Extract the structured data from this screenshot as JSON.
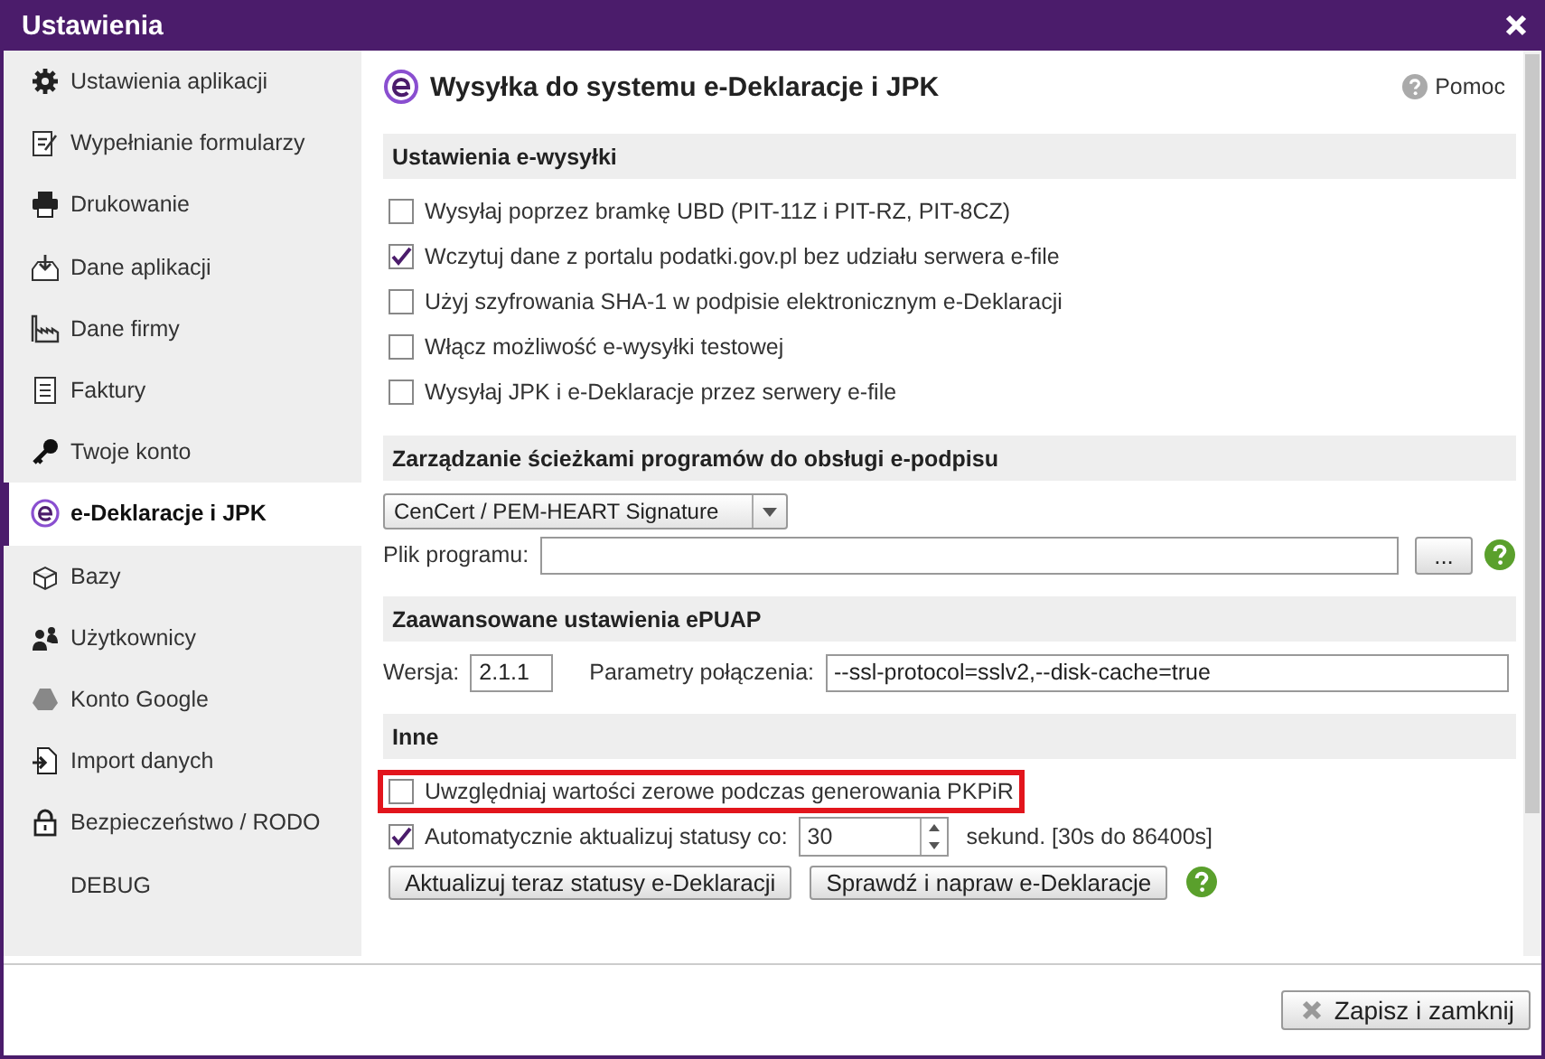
{
  "window": {
    "title": "Ustawienia"
  },
  "sidebar": {
    "items": [
      {
        "label": "Ustawienia aplikacji",
        "selected": false
      },
      {
        "label": "Wypełnianie formularzy",
        "selected": false
      },
      {
        "label": "Drukowanie",
        "selected": false
      },
      {
        "label": "Dane aplikacji",
        "selected": false
      },
      {
        "label": "Dane firmy",
        "selected": false
      },
      {
        "label": "Faktury",
        "selected": false
      },
      {
        "label": "Twoje konto",
        "selected": false
      },
      {
        "label": "e-Deklaracje i JPK",
        "selected": true
      },
      {
        "label": "Bazy",
        "selected": false
      },
      {
        "label": "Użytkownicy",
        "selected": false
      },
      {
        "label": "Konto Google",
        "selected": false
      },
      {
        "label": "Import danych",
        "selected": false
      },
      {
        "label": "Bezpieczeństwo / RODO",
        "selected": false
      },
      {
        "label": "DEBUG",
        "selected": false
      }
    ]
  },
  "page": {
    "title": "Wysyłka do systemu e-Deklaracje i JPK",
    "help": "Pomoc"
  },
  "sections": [
    {
      "title": "Ustawienia e-wysyłki",
      "rows": [
        {
          "kind": "checkbox",
          "label": "Wysyłaj poprzez bramkę UBD (PIT-11Z i PIT-RZ, PIT-8CZ)",
          "checked": false,
          "highlighted": false
        },
        {
          "kind": "checkbox",
          "label": "Wczytuj dane z portalu podatki.gov.pl bez udziału serwera e-file",
          "checked": true,
          "highlighted": false
        },
        {
          "kind": "checkbox",
          "label": "Użyj szyfrowania SHA-1 w podpisie elektronicznym e-Deklaracji",
          "checked": false,
          "highlighted": false
        },
        {
          "kind": "checkbox",
          "label": "Włącz możliwość e-wysyłki testowej",
          "checked": false,
          "highlighted": false
        },
        {
          "kind": "checkbox",
          "label": "Wysyłaj JPK i e-Deklaracje przez serwery e-file",
          "checked": false,
          "highlighted": false
        }
      ]
    },
    {
      "title": "Zarządzanie ścieżkami programów do obsługi e-podpisu",
      "rows": [
        {
          "kind": "select",
          "value": "CenCert / PEM-HEART Signature"
        },
        {
          "kind": "file",
          "label": "Plik programu:",
          "button": "..."
        }
      ]
    },
    {
      "title": "Zaawansowane ustawienia ePUAP",
      "rows": [
        {
          "kind": "fields",
          "fields": [
            {
              "label": "Wersja:",
              "value": "2.1.1"
            },
            {
              "label": "Parametry połączenia:",
              "value": "--ssl-protocol=sslv2,--disk-cache=true"
            }
          ]
        }
      ]
    },
    {
      "title": "Inne",
      "rows": [
        {
          "kind": "checkbox",
          "label": "Uwzględniaj wartości zerowe podczas generowania PKPiR",
          "checked": false,
          "highlighted": true
        },
        {
          "kind": "spin",
          "label": "Automatycznie aktualizuj statusy co:",
          "checked": true,
          "value": "30",
          "suffix": "sekund. [30s do 86400s]"
        },
        {
          "kind": "buttons",
          "buttons": [
            "Aktualizuj teraz statusy e-Deklaracji",
            "Sprawdź i napraw e-Deklaracje"
          ]
        }
      ]
    }
  ],
  "footer": {
    "button": "Zapisz i zamknij"
  }
}
